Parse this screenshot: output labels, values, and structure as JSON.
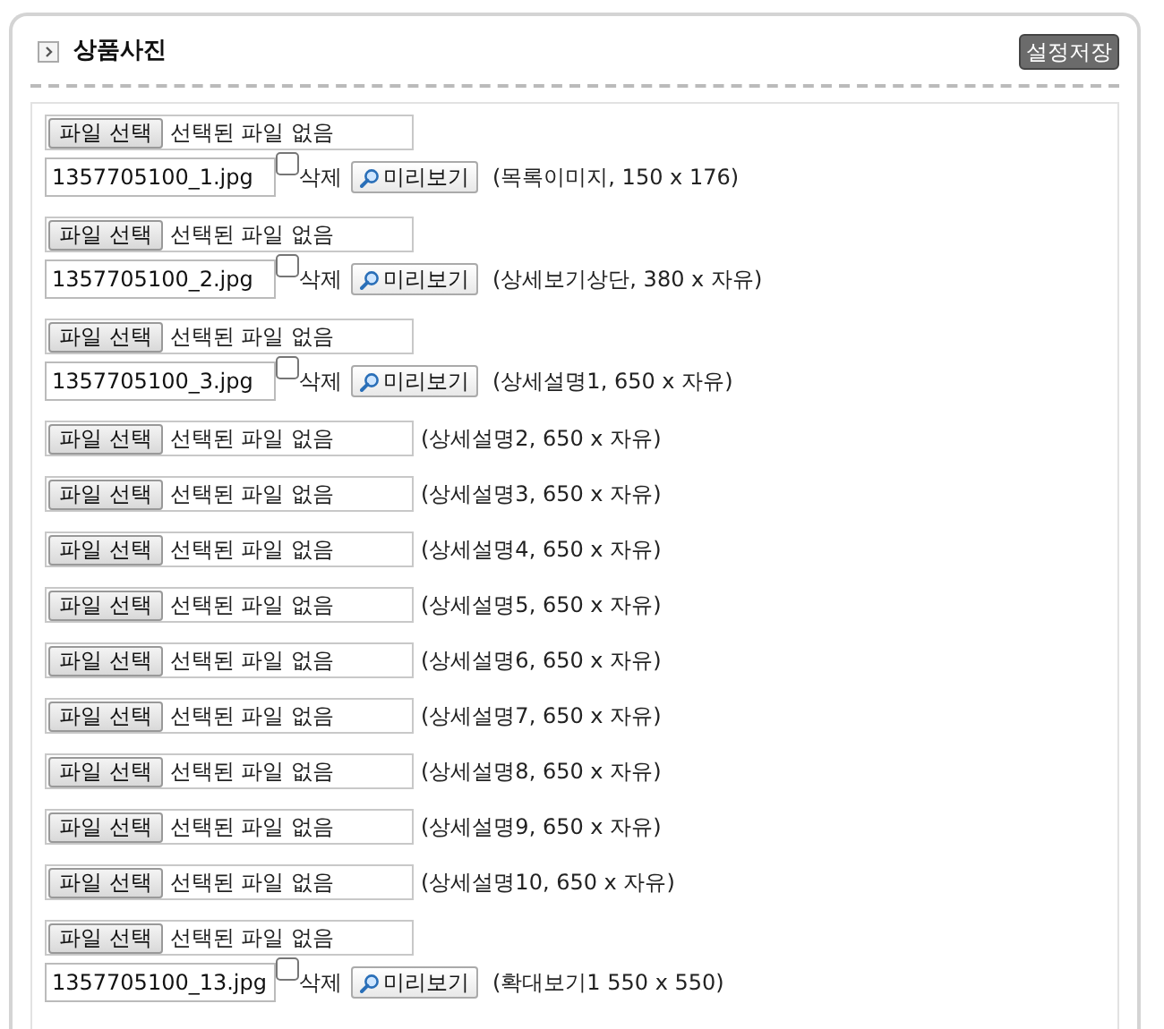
{
  "panel": {
    "title": "상품사진",
    "save_button": "설정저장"
  },
  "entries": [
    {
      "kind": "with_file",
      "file_button": "파일 선택",
      "file_status": "선택된 파일 없음",
      "filename": "1357705100_1.jpg",
      "delete_label": "삭제",
      "delete_checked": false,
      "preview_button": "미리보기",
      "note": "(목록이미지, 150 x 176)"
    },
    {
      "kind": "with_file",
      "file_button": "파일 선택",
      "file_status": "선택된 파일 없음",
      "filename": "1357705100_2.jpg",
      "delete_label": "삭제",
      "delete_checked": false,
      "preview_button": "미리보기",
      "note": "(상세보기상단, 380 x 자유)"
    },
    {
      "kind": "with_file",
      "file_button": "파일 선택",
      "file_status": "선택된 파일 없음",
      "filename": "1357705100_3.jpg",
      "delete_label": "삭제",
      "delete_checked": false,
      "preview_button": "미리보기",
      "note": "(상세설명1, 650 x 자유)"
    },
    {
      "kind": "empty",
      "file_button": "파일 선택",
      "file_status": "선택된 파일 없음",
      "note": "(상세설명2, 650 x 자유)"
    },
    {
      "kind": "empty",
      "file_button": "파일 선택",
      "file_status": "선택된 파일 없음",
      "note": "(상세설명3, 650 x 자유)"
    },
    {
      "kind": "empty",
      "file_button": "파일 선택",
      "file_status": "선택된 파일 없음",
      "note": "(상세설명4, 650 x 자유)"
    },
    {
      "kind": "empty",
      "file_button": "파일 선택",
      "file_status": "선택된 파일 없음",
      "note": "(상세설명5, 650 x 자유)"
    },
    {
      "kind": "empty",
      "file_button": "파일 선택",
      "file_status": "선택된 파일 없음",
      "note": "(상세설명6, 650 x 자유)"
    },
    {
      "kind": "empty",
      "file_button": "파일 선택",
      "file_status": "선택된 파일 없음",
      "note": "(상세설명7, 650 x 자유)"
    },
    {
      "kind": "empty",
      "file_button": "파일 선택",
      "file_status": "선택된 파일 없음",
      "note": "(상세설명8, 650 x 자유)"
    },
    {
      "kind": "empty",
      "file_button": "파일 선택",
      "file_status": "선택된 파일 없음",
      "note": "(상세설명9, 650 x 자유)"
    },
    {
      "kind": "empty",
      "file_button": "파일 선택",
      "file_status": "선택된 파일 없음",
      "note": "(상세설명10, 650 x 자유)"
    },
    {
      "kind": "with_file",
      "file_button": "파일 선택",
      "file_status": "선택된 파일 없음",
      "filename": "1357705100_13.jpg",
      "delete_label": "삭제",
      "delete_checked": false,
      "preview_button": "미리보기",
      "note": "(확대보기1 550 x 550)"
    }
  ]
}
